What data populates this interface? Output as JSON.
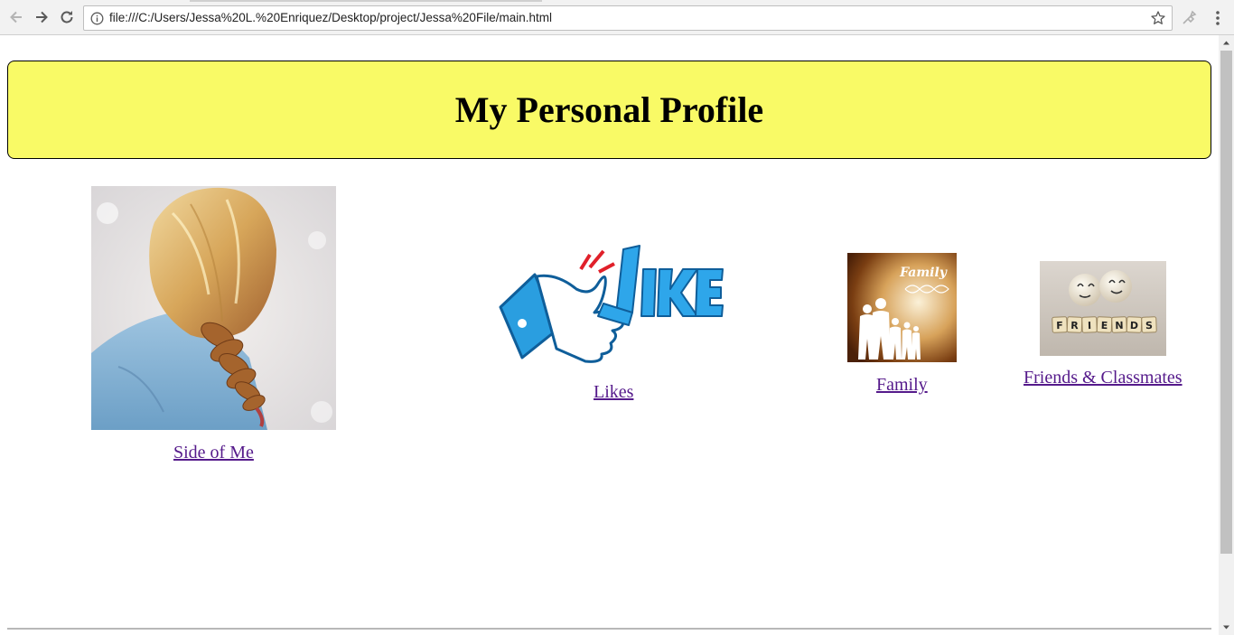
{
  "browser": {
    "url": "file:///C:/Users/Jessa%20L.%20Enriquez/Desktop/project/Jessa%20File/main.html"
  },
  "page": {
    "title": "My Personal Profile",
    "header_color": "#f9fa66",
    "link_color": "#551a8b",
    "links": {
      "side_of_me": "Side of Me",
      "likes": "Likes",
      "family": "Family",
      "friends": "Friends & Classmates"
    },
    "images": {
      "family_caption": "Family",
      "friends_tiles": [
        "F",
        "R",
        "I",
        "E",
        "N",
        "D",
        "S"
      ]
    }
  }
}
